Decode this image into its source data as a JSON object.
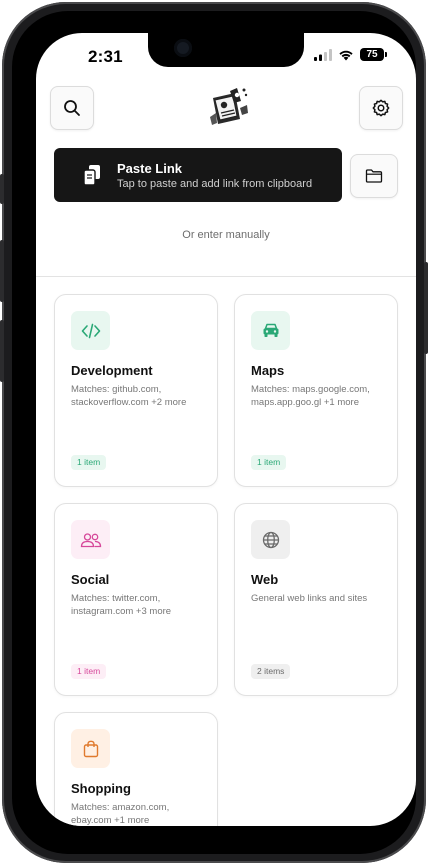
{
  "status_bar": {
    "time": "2:31",
    "battery": "75"
  },
  "header": {
    "search_icon": "search-icon",
    "settings_icon": "gear-icon",
    "logo_icon": "app-logo"
  },
  "paste_link": {
    "title": "Paste Link",
    "subtitle": "Tap to paste and add link from clipboard",
    "icon": "clipboard-icon"
  },
  "folder_button": {
    "icon": "folder-icon"
  },
  "manual_entry": {
    "label": "Or enter manually"
  },
  "categories": [
    {
      "name": "Development",
      "desc": "Matches: github.com, stackoverflow.com +2 more",
      "count": "1 item",
      "icon": "code-icon",
      "tint": "#e8f7f0",
      "color": "#2aa876"
    },
    {
      "name": "Maps",
      "desc": "Matches: maps.google.com, maps.app.goo.gl +1 more",
      "count": "1 item",
      "icon": "car-icon",
      "tint": "#e8f7f0",
      "color": "#2aa876"
    },
    {
      "name": "Social",
      "desc": "Matches: twitter.com, instagram.com +3 more",
      "count": "1 item",
      "icon": "users-icon",
      "tint": "#fdeef6",
      "color": "#d6489a"
    },
    {
      "name": "Web",
      "desc": "General web links and sites",
      "count": "2 items",
      "icon": "globe-icon",
      "tint": "#efefef",
      "color": "#6b6b6b"
    },
    {
      "name": "Shopping",
      "desc": "Matches: amazon.com, ebay.com +1 more",
      "count": "",
      "icon": "shopping-bag-icon",
      "tint": "#fff0e4",
      "color": "#e07a2e"
    }
  ]
}
